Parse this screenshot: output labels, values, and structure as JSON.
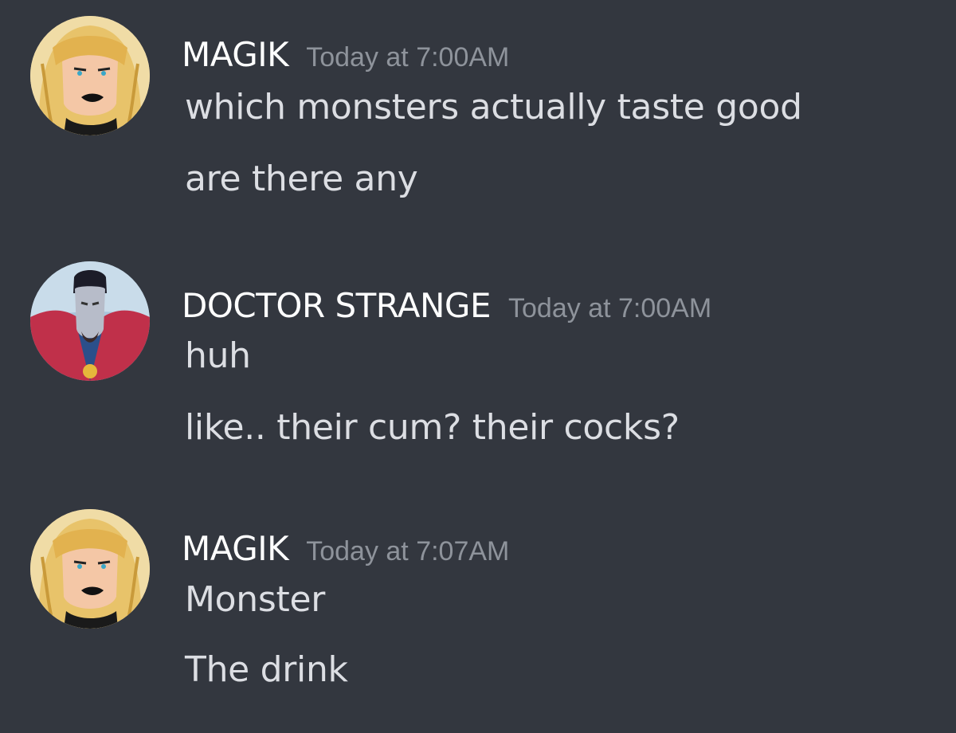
{
  "messages": [
    {
      "author": "MAGIK",
      "time": "Today at 7:00AM",
      "lines": [
        "which monsters actually taste good",
        "are there any"
      ]
    },
    {
      "author": "DOCTOR STRANGE",
      "time": "Today at 7:00AM",
      "lines": [
        "huh",
        "like.. their cum? their cocks?"
      ]
    },
    {
      "author": "MAGIK",
      "time": "Today at 7:07AM",
      "lines": [
        "Monster",
        "The drink"
      ]
    }
  ]
}
